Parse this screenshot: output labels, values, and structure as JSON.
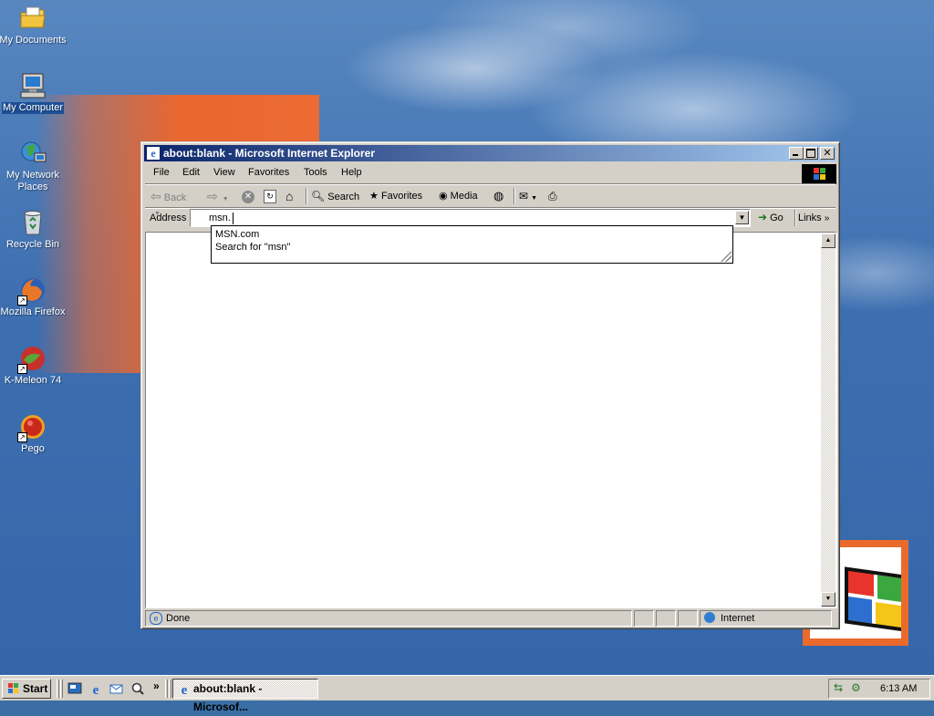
{
  "desktop": {
    "icons": [
      {
        "label": "My Documents"
      },
      {
        "label": "My Computer"
      },
      {
        "label": "My Network Places"
      },
      {
        "label": "Recycle Bin"
      },
      {
        "label": "Mozilla Firefox"
      },
      {
        "label": "K-Meleon 74"
      },
      {
        "label": "Pego"
      }
    ]
  },
  "window": {
    "title": "about:blank - Microsoft Internet Explorer",
    "menu": [
      "File",
      "Edit",
      "View",
      "Favorites",
      "Tools",
      "Help"
    ],
    "toolbar": {
      "back_label": "Back",
      "search_label": "Search",
      "favorites_label": "Favorites",
      "media_label": "Media"
    },
    "address": {
      "label": "Address",
      "value": "msn.",
      "go_label": "Go",
      "links_label": "Links"
    },
    "autocomplete": [
      "MSN.com",
      "Search for \"msn\""
    ],
    "status": {
      "text": "Done",
      "zone": "Internet"
    }
  },
  "taskbar": {
    "start_label": "Start",
    "task_label": "about:blank - Microsof...",
    "clock": "6:13 AM"
  },
  "colors": {
    "titlebar_start": "#0a246a",
    "titlebar_end": "#a6caf0",
    "chrome": "#d4d0c8",
    "desktop": "#3a6ea5",
    "wallpaper_orange": "#ec6a33"
  }
}
